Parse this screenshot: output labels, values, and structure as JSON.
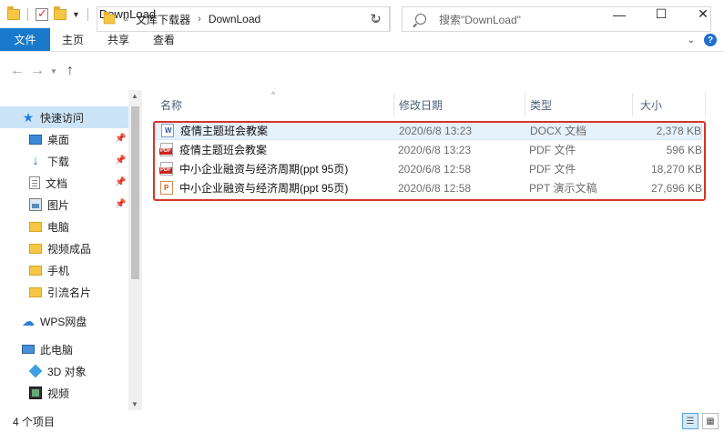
{
  "window": {
    "title": "DownLoad",
    "controls": {
      "minimize": "—",
      "maximize": "☐",
      "close": "✕"
    }
  },
  "ribbon": {
    "tabs": [
      "文件",
      "主页",
      "共享",
      "查看"
    ],
    "help": "?"
  },
  "address": {
    "overflow": "«",
    "crumbs": [
      "文库下载器",
      "DownLoad"
    ],
    "refresh": "↻",
    "search_placeholder": "搜索\"DownLoad\""
  },
  "nav": {
    "quick_access": "快速访问",
    "items": [
      {
        "label": "桌面",
        "icon": "desktop-icon",
        "pinned": true
      },
      {
        "label": "下载",
        "icon": "download-icon",
        "pinned": true
      },
      {
        "label": "文档",
        "icon": "document-icon",
        "pinned": true
      },
      {
        "label": "图片",
        "icon": "picture-icon",
        "pinned": true
      },
      {
        "label": "电脑",
        "icon": "folder-icon",
        "pinned": false
      },
      {
        "label": "视频成品",
        "icon": "folder-icon",
        "pinned": false
      },
      {
        "label": "手机",
        "icon": "folder-icon",
        "pinned": false
      },
      {
        "label": "引流名片",
        "icon": "folder-icon",
        "pinned": false
      }
    ],
    "wps": "WPS网盘",
    "this_pc": "此电脑",
    "pc_items": [
      {
        "label": "3D 对象",
        "icon": "3d-objects-icon"
      },
      {
        "label": "视频",
        "icon": "video-icon"
      }
    ]
  },
  "columns": {
    "name": "名称",
    "date": "修改日期",
    "type": "类型",
    "size": "大小"
  },
  "files": [
    {
      "name": "疫情主题班会教案",
      "date": "2020/6/8 13:23",
      "type": "DOCX 文档",
      "size": "2,378 KB",
      "icon": "docx"
    },
    {
      "name": "疫情主题班会教案",
      "date": "2020/6/8 13:23",
      "type": "PDF 文件",
      "size": "596 KB",
      "icon": "pdf"
    },
    {
      "name": "中小企业融资与经济周期(ppt 95页)",
      "date": "2020/6/8 12:58",
      "type": "PDF 文件",
      "size": "18,270 KB",
      "icon": "pdf"
    },
    {
      "name": "中小企业融资与经济周期(ppt 95页)",
      "date": "2020/6/8 12:58",
      "type": "PPT 演示文稿",
      "size": "27,696 KB",
      "icon": "ppt"
    }
  ],
  "status": {
    "count": "4 个项目"
  },
  "colors": {
    "accent": "#1979ca",
    "highlight_box": "#d8332b",
    "selection": "#cce4f7"
  }
}
